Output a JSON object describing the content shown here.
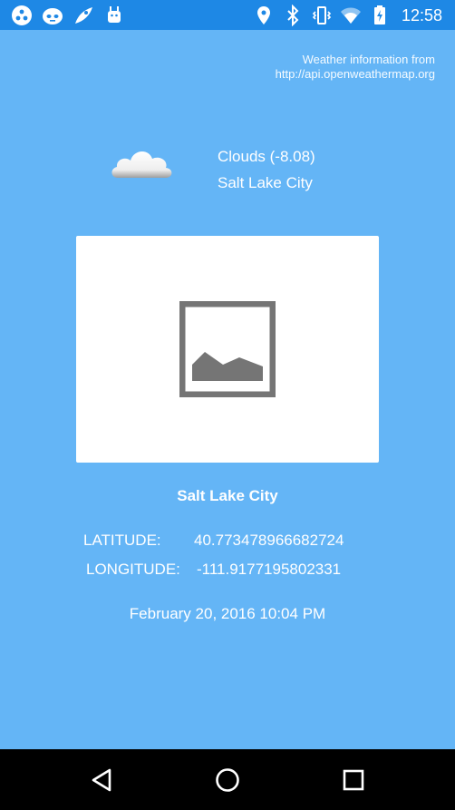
{
  "status_bar": {
    "time": "12:58",
    "left_icons": [
      "blockchain-icon",
      "alien-face-icon",
      "rocket-icon",
      "android-icon"
    ],
    "right_icons": [
      "location-icon",
      "bluetooth-icon",
      "vibrate-icon",
      "wifi-icon",
      "battery-charging-icon"
    ]
  },
  "source": {
    "line1": "Weather information from",
    "line2": "http://api.openweathermap.org"
  },
  "weather": {
    "icon": "clouds-icon",
    "condition": "Clouds (-8.08)",
    "city": "Salt Lake City"
  },
  "image_placeholder": {
    "icon": "image-placeholder-icon"
  },
  "location": {
    "city": "Salt Lake City",
    "latitude_label": "LATITUDE:",
    "latitude_value": "40.773478966682724",
    "longitude_label": "LONGITUDE:",
    "longitude_value": "-111.9177195802331"
  },
  "date": "February 20, 2016 10:04 PM",
  "nav_bar": {
    "back": "back-icon",
    "home": "home-icon",
    "recents": "recents-icon"
  },
  "colors": {
    "background": "#64b5f6",
    "status_bar": "#1e88e5",
    "nav_bar": "#000000",
    "card": "#ffffff"
  }
}
